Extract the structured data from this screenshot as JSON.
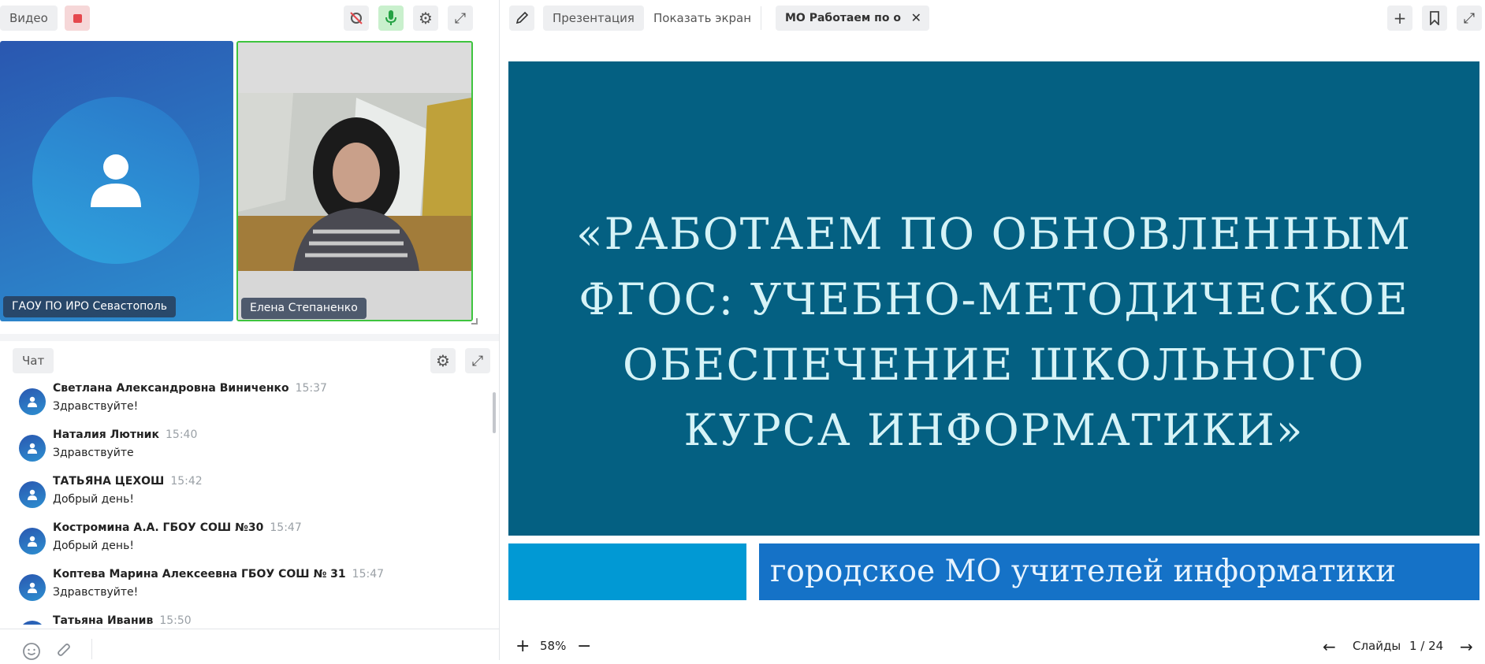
{
  "video": {
    "toolbar_label": "Видео",
    "participants": [
      {
        "name": "ГАОУ ПО ИРО Севастополь"
      },
      {
        "name": "Елена Степаненко"
      }
    ]
  },
  "chat": {
    "tab_label": "Чат",
    "messages": [
      {
        "author": "Светлана Александровна Виниченко",
        "time": "15:37",
        "text": "Здравствуйте!"
      },
      {
        "author": "Наталия Лютник",
        "time": "15:40",
        "text": "Здравствуйте"
      },
      {
        "author": "ТАТЬЯНА ЦЕХОШ",
        "time": "15:42",
        "text": "Добрый день!"
      },
      {
        "author": "Костромина А.А. ГБОУ СОШ №30",
        "time": "15:47",
        "text": "Добрый день!"
      },
      {
        "author": "Коптева Марина Алексеевна ГБОУ СОШ № 31",
        "time": "15:47",
        "text": "Здравствуйте!"
      },
      {
        "author": "Татьяна Иванив",
        "time": "15:50",
        "text": ""
      }
    ]
  },
  "presentation": {
    "tabs": {
      "presentation": "Презентация",
      "share_screen": "Показать экран",
      "file": "МО Работаем по о"
    },
    "slide": {
      "title": "«РАБОТАЕМ ПО ОБНОВЛЕННЫМ ФГОС: УЧЕБНО-МЕТОДИЧЕСКОЕ ОБЕСПЕЧЕНИЕ ШКОЛЬНОГО КУРСА ИНФОРМАТИКИ»",
      "subtitle": "городское МО учителей информатики"
    },
    "zoom": "58%",
    "slides_label": "Слайды",
    "page": "1 / 24"
  },
  "colors": {
    "slide_band": "#046082",
    "accent_green": "#3ec43e",
    "record_red": "#e5484d"
  }
}
